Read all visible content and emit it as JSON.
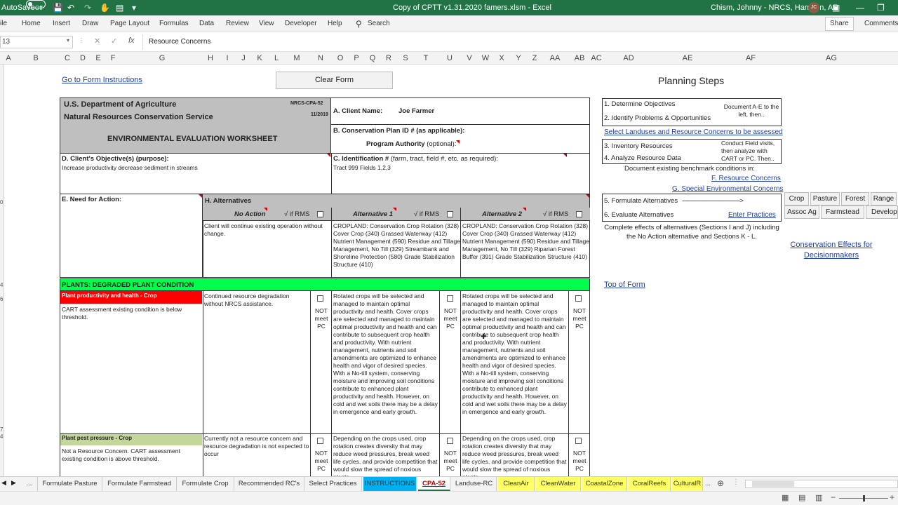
{
  "titlebar": {
    "autosave_label": "AutoSave",
    "autosave_state": "Off",
    "doc_title": "Copy of CPTT v1.31.2020 famers.xlsm  -  Excel",
    "user": "Chism, Johnny - NRCS, Harrison, AR",
    "user_initials": "JC"
  },
  "ribbon": {
    "tabs": [
      "ile",
      "Home",
      "Insert",
      "Draw",
      "Page Layout",
      "Formulas",
      "Data",
      "Review",
      "View",
      "Developer",
      "Help"
    ],
    "search": "Search",
    "share": "Share",
    "comments": "Comments"
  },
  "formula_bar": {
    "name_box": "13",
    "content": "Resource Concerns"
  },
  "columns": [
    "A",
    "B",
    "C",
    "D",
    "E",
    "F",
    "G",
    "H",
    "I",
    "J",
    "K",
    "L",
    "M",
    "N",
    "O",
    "P",
    "Q",
    "R",
    "S",
    "T",
    "U",
    "V",
    "W",
    "X",
    "Y",
    "Z",
    "AA",
    "AB",
    "AC",
    "AD",
    "AE",
    "AF",
    "AG"
  ],
  "rows": [
    "0",
    "4",
    "6",
    "7",
    "4"
  ],
  "form": {
    "instructions_link": "Go to Form Instructions",
    "clear_button": "Clear Form",
    "agency_line1": "U.S. Department of Agriculture",
    "agency_line2": "Natural Resources Conservation Service",
    "form_code": "NRCS-CPA-52",
    "form_date": "11/2019",
    "worksheet_title": "ENVIRONMENTAL EVALUATION WORKSHEET",
    "client_label": "A.  Client Name:",
    "client_name": "Joe Farmer",
    "plan_label": "B. Conservation Plan ID # ",
    "plan_note": "(as applicable):",
    "authority_label": "Program Authority ",
    "authority_note": "(optional):",
    "objective_label": "D.  Client's Objective(s) (purpose):",
    "objective_text": "Increase productivity decrease sediment in streams",
    "ident_label": "C. Identification # ",
    "ident_note": "(farm, tract, field #, etc. as required):",
    "ident_text": "Tract 999 Fields 1,2,3",
    "need_label": "E.  Need for Action:",
    "alt_header": "H.  Alternatives",
    "alt_cols": [
      {
        "name": "No Action",
        "rms": "√ if RMS",
        "text": "Client will continue existing  operation without change."
      },
      {
        "name": "Alternative 1",
        "rms": "√ if RMS",
        "text": "CROPLAND: Conservation Crop Rotation (328) Cover Crop (340) Grassed Waterway (412) Nutrient Management (590) Residue and Tillage Management, No Till (329) Streambank and Shoreline Protection (580) Grade Stabilization Structure (410)"
      },
      {
        "name": "Alternative 2",
        "rms": "√ if RMS",
        "text": "CROPLAND: Conservation Crop Rotation (328) Cover Crop (340) Grassed Waterway (412) Nutrient Management (590) Residue and Tillage Management, No Till (329) Riparian Forest Buffer (391) Grade Stabilization Structure (410)"
      }
    ],
    "section_header": "PLANTS: DEGRADED PLANT CONDITION",
    "rows": [
      {
        "concern": "Plant productivity and health - Crop",
        "desc": "CART assessment existing condition is below threshold.",
        "noaction": "Continued resource degradation without NRCS assistance.",
        "alt1": "Rotated crops will be selected and managed to maintain optimal productivity and health. Cover crops are selected and managed to maintain optimal productivity and health and can contribute to subsequent crop health and productivity. With nutrient management, nutrients and soil amendments are optimized to enhance health and vigor of desired species. With a No-till system, conserving moisture and improving soil conditions contribute to enhanced plant productivity and health. However, on cold and wet soils there may be a delay in emergence and early growth.",
        "alt2": "Rotated crops will be selected and managed to maintain optimal productivity and health. Cover crops are selected and managed to maintain optimal productivity and health and can contribute to subsequent crop health and productivity. With nutrient management, nutrients and soil amendments are optimized to enhance health and vigor of desired species. With a No-till system, conserving moisture and improving soil conditions contribute to enhanced plant productivity and health. However, on cold and wet soils there may be a delay in emergence and early growth.",
        "notmeet": "NOT meet PC"
      },
      {
        "concern": "Plant pest pressure - Crop",
        "desc": "Not a Resource Concern. CART assessment existing condition is above threshold.",
        "noaction": "Currently not a resource concern and resource degradation is not expected to occur",
        "alt1": "Depending on the crops used, crop rotation creates diversity that may reduce weed pressures, break weed life cycles, and provide competition that would slow the spread of noxious plants.",
        "alt2": "Depending on the crops used, crop rotation creates diversity that may reduce weed pressures, break weed life cycles, and provide competition that would slow the spread of noxious plants.",
        "notmeet": "NOT meet PC"
      }
    ]
  },
  "planning": {
    "title": "Planning Steps",
    "step1": "1. Determine Objectives",
    "step2": "2. Identify Problems & Opportunities",
    "note12": "Document A-E to the left, then..",
    "select_link": "Select Landuses and Resource Concerns to be assessed",
    "step3": "3. Inventory Resources",
    "step4": "4. Analyze Resource Data",
    "note34": "Conduct Field visits, then analyze with CART or PC. Then..",
    "benchmark": "Document existing benchmark conditions in:",
    "link_f": "F. Resource Concerns",
    "link_g": "G. Special Environmental Concerns",
    "step5": "5. Formulate Alternatives",
    "step5_arrow": "-------------------------------------->",
    "step6": "6. Evaluate Alternatives",
    "enter_link": "Enter Practices",
    "complete_text": "Complete effects of alternatives (Sections I and J) including the No Action alternative and Sections K - L.",
    "effects_link": "Conservation Effects for Decisionmakers",
    "top_link": "Top of Form",
    "landuse_buttons": [
      "Crop",
      "Pasture",
      "Forest",
      "Range",
      "Assoc Ag",
      "Farmstead",
      "Develop"
    ]
  },
  "sheet_tabs": [
    "...",
    "Formulate Pasture",
    "Formulate Farmstead",
    "Formulate Crop",
    "Recommended RC's",
    "Select Practices",
    "INSTRUCTIONS",
    "CPA-52",
    "Landuse-RC",
    "CleanAir",
    "CleanWater",
    "CoastalZone",
    "CoralReefs",
    "CulturalR",
    "..."
  ],
  "colors": {
    "excel_green": "#217346",
    "section_green": "#00ff4c",
    "crop_red": "#ff0000",
    "pest_olive": "#c4d79b",
    "alt_header_gray": "#bfbfbf",
    "instructions_tab": "#00b0f0",
    "cleanair_tab": "#ffff66"
  }
}
